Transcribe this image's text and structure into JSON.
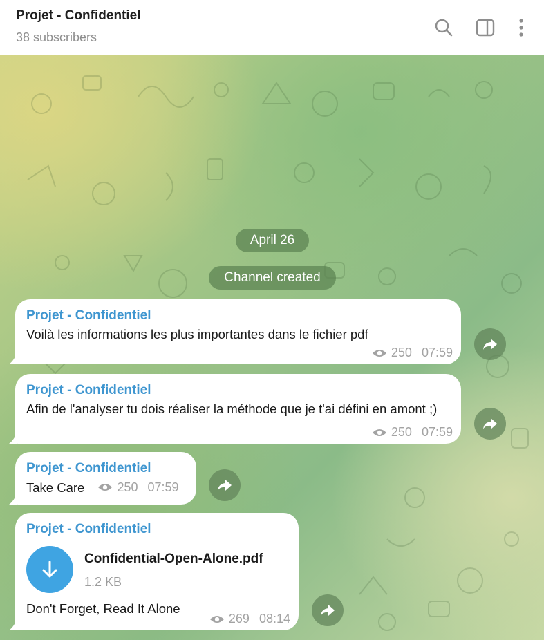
{
  "header": {
    "title": "Projet - Confidentiel",
    "subtitle": "38 subscribers",
    "icons": [
      "search-icon",
      "sidebar-toggle-icon",
      "more-vertical-icon"
    ]
  },
  "service": {
    "date": "April 26",
    "created": "Channel created"
  },
  "messages": [
    {
      "sender": "Projet - Confidentiel",
      "text": "Voilà les informations les plus importantes dans le fichier pdf",
      "views": "250",
      "time": "07:59"
    },
    {
      "sender": "Projet - Confidentiel",
      "text": "Afin de l'analyser tu dois réaliser la méthode que je t'ai défini en amont ;)",
      "views": "250",
      "time": "07:59"
    },
    {
      "sender": "Projet - Confidentiel",
      "text": "Take Care",
      "views": "250",
      "time": "07:59"
    },
    {
      "sender": "Projet - Confidentiel",
      "file_name": "Confidential-Open-Alone.pdf",
      "file_size": "1.2 KB",
      "text": "Don't Forget, Read It Alone",
      "views": "269",
      "time": "08:14"
    }
  ],
  "colors": {
    "sender": "#3f96d0",
    "file_icon": "#3fa4e2",
    "pill_bg": "#5c8252"
  }
}
